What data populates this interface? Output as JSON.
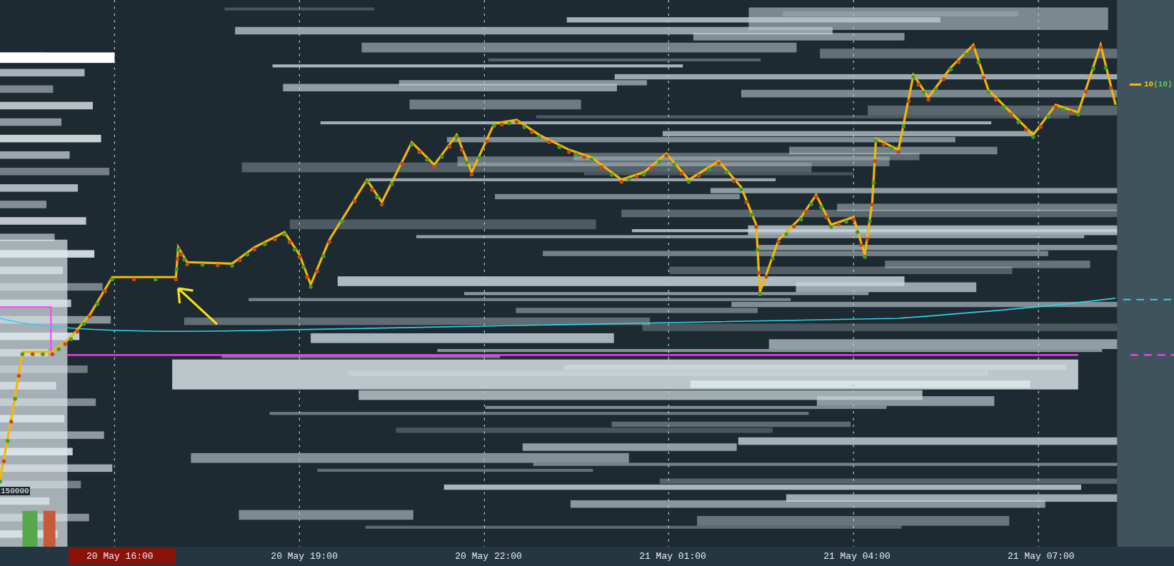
{
  "chart": {
    "price_label": "150000",
    "legend": {
      "value": "10",
      "count": "(10)"
    }
  },
  "time_axis": [
    {
      "label": "20 May 16:00",
      "highlighted": true
    },
    {
      "label": "20 May 19:00",
      "highlighted": false
    },
    {
      "label": "20 May 22:00",
      "highlighted": false
    },
    {
      "label": "21 May 01:00",
      "highlighted": false
    },
    {
      "label": "21 May 04:00",
      "highlighted": false
    },
    {
      "label": "21 May 07:00",
      "highlighted": false
    }
  ]
}
